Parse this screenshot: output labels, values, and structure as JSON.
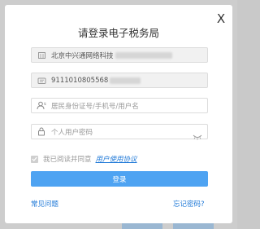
{
  "dialog": {
    "title": "请登录电子税务局",
    "close_label": "X"
  },
  "fields": {
    "company": {
      "value_prefix": "北京中兴通网络科技",
      "icon": "building-icon"
    },
    "tax_id": {
      "value_prefix": "9111010805568",
      "icon": "id-card-icon"
    },
    "account": {
      "placeholder": "居民身份证号/手机号/用户名",
      "icon": "user-icon"
    },
    "password": {
      "placeholder": "个人用户密码",
      "icon": "lock-icon",
      "toggle_icon": "eye-closed-icon"
    }
  },
  "agreement": {
    "label": "我已阅读并同意",
    "link": "用户使用协议",
    "checked": true
  },
  "login_button": "登录",
  "links": {
    "faq": "常见问题",
    "forgot_password": "忘记密码?"
  },
  "background": {
    "watermark": "©…"
  },
  "colors": {
    "primary_button": "#4ea3f2",
    "link": "#1e78d7",
    "overlay": "#cdcdcd"
  }
}
